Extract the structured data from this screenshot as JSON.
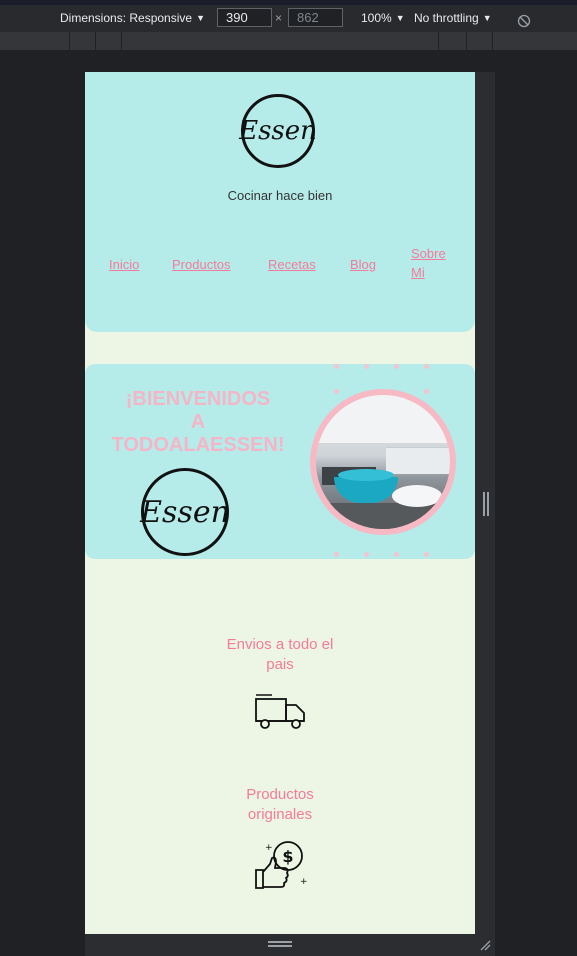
{
  "devtools": {
    "dimensions_label": "Dimensions: Responsive",
    "width": "390",
    "height": "862",
    "zoom": "100%",
    "throttling": "No throttling"
  },
  "site": {
    "logo_text": "Essen",
    "tagline": "Cocinar hace bien",
    "nav": [
      "Inicio",
      "Productos",
      "Recetas",
      "Blog",
      "Sobre Mi"
    ],
    "hero": {
      "welcome_line1": "¡BIENVENIDOS",
      "welcome_line2": "A",
      "welcome_line3": "TODOALAESSEN!",
      "logo_text": "Essen"
    },
    "features": [
      {
        "title_line1": "Envios a todo el",
        "title_line2": "pais",
        "icon": "delivery-truck-icon"
      },
      {
        "title_line1": "Productos",
        "title_line2": "originales",
        "icon": "thumbs-up-dollar-icon"
      }
    ]
  },
  "colors": {
    "header_bg": "#b5ecea",
    "page_bg": "#edf6e5",
    "link": "#f47b9b",
    "welcome": "#f6b5c6"
  }
}
